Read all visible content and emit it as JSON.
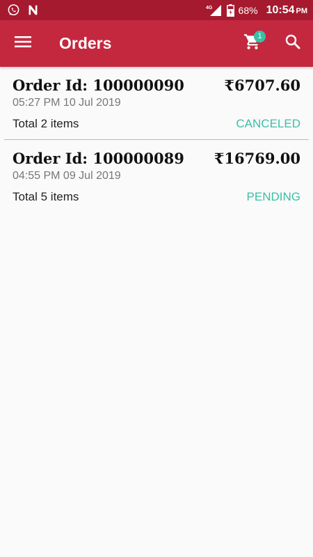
{
  "status_bar": {
    "network": "4G",
    "battery_percent": "68%",
    "time": "10:54",
    "time_suffix": "PM",
    "icons": [
      "whatsapp-icon",
      "n-app-icon",
      "signal-icon",
      "battery-icon"
    ]
  },
  "app_bar": {
    "title": "Orders",
    "cart_badge": "1",
    "icons": [
      "menu-icon",
      "cart-icon",
      "search-icon"
    ]
  },
  "orders": [
    {
      "id_label": "Order Id: 100000090",
      "price": "₹6707.60",
      "date": "05:27 PM 10 Jul 2019",
      "total": "Total 2 items",
      "status": "CANCELED"
    },
    {
      "id_label": "Order Id: 100000089",
      "price": "₹16769.00",
      "date": "04:55 PM 09 Jul 2019",
      "total": "Total 5 items",
      "status": "PENDING"
    }
  ],
  "colors": {
    "status_bar": "#a51a2e",
    "app_bar": "#c4283f",
    "accent": "#3bbfa6",
    "background": "#fafafa"
  }
}
